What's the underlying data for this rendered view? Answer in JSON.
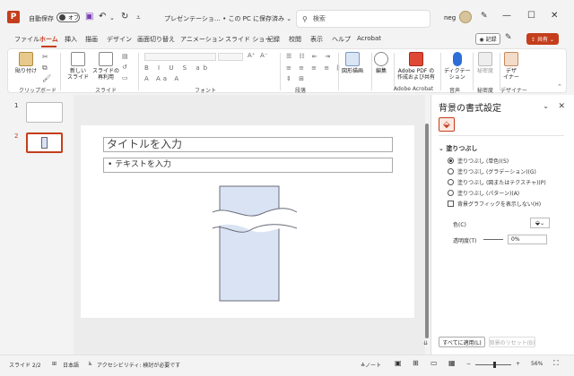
{
  "titlebar": {
    "logo": "P",
    "autosave_label": "自動保存",
    "toggle_state": "オフ",
    "save_icon": "save-icon",
    "undo_icon": "undo-icon",
    "redo_icon": "redo-icon",
    "doc_title": "プレゼンテーショ… • この PC に保存済み ⌄",
    "search_placeholder": "検索",
    "user_name": "neg",
    "minimize": "—",
    "maximize": "☐",
    "close": "✕"
  },
  "tabs": [
    "ファイル",
    "ホーム",
    "挿入",
    "描画",
    "デザイン",
    "画面切り替え",
    "アニメーション",
    "スライド ショー",
    "記録",
    "校閲",
    "表示",
    "ヘルプ",
    "Acrobat"
  ],
  "active_tab": "ホーム",
  "tab_buttons": {
    "record": "◉ 記録",
    "share": "⇪ 共有 ⌄"
  },
  "ribbon": {
    "paste_label": "貼り付け",
    "clipboard_group": "クリップボード",
    "new_slide_label": "新しい\nスライド",
    "reuse_label": "スライドの\n再利用",
    "slides_group": "スライド",
    "font_group": "フォント",
    "paragraph_group": "段落",
    "shapes_label": "図形描画",
    "edit_label": "編集",
    "adobe_pdf_label": "Adobe PDF の\n作成および共有",
    "adobe_group": "Adobe Acrobat",
    "dictate_label": "ディクテー\nション",
    "voice_group": "音声",
    "sensitivity_label": "秘密度",
    "sensitivity_group": "秘密度",
    "designer_label": "デザ\nイナー",
    "designer_group": "デザイナー"
  },
  "thumbnails": [
    {
      "num": "1"
    },
    {
      "num": "2"
    }
  ],
  "slide": {
    "title_placeholder": "タイトルを入力",
    "body_placeholder": "• テキストを入力"
  },
  "pane": {
    "title": "背景の書式設定",
    "fill_section": "塗りつぶし",
    "options": [
      {
        "label": "塗りつぶし (単色)(S)",
        "selected": true
      },
      {
        "label": "塗りつぶし (グラデーション)(G)",
        "selected": false
      },
      {
        "label": "塗りつぶし (図またはテクスチャ)(P)",
        "selected": false
      },
      {
        "label": "塗りつぶし (パターン)(A)",
        "selected": false
      }
    ],
    "hide_bg_graphics": "背景グラフィックを表示しない(H)",
    "color_label": "色(C)",
    "transparency_label": "透明度(T)",
    "transparency_value": "0%",
    "apply_all": "すべてに適用(L)",
    "reset_bg": "背景のリセット(B)"
  },
  "status": {
    "slide_info": "スライド 2/2",
    "language": "日本語",
    "accessibility": "アクセシビリティ: 検討が必要です",
    "notes": "≜ノート",
    "zoom": "56%"
  },
  "colors": {
    "accent": "#c43e1c",
    "shape_fill": "#d9e3f3"
  }
}
